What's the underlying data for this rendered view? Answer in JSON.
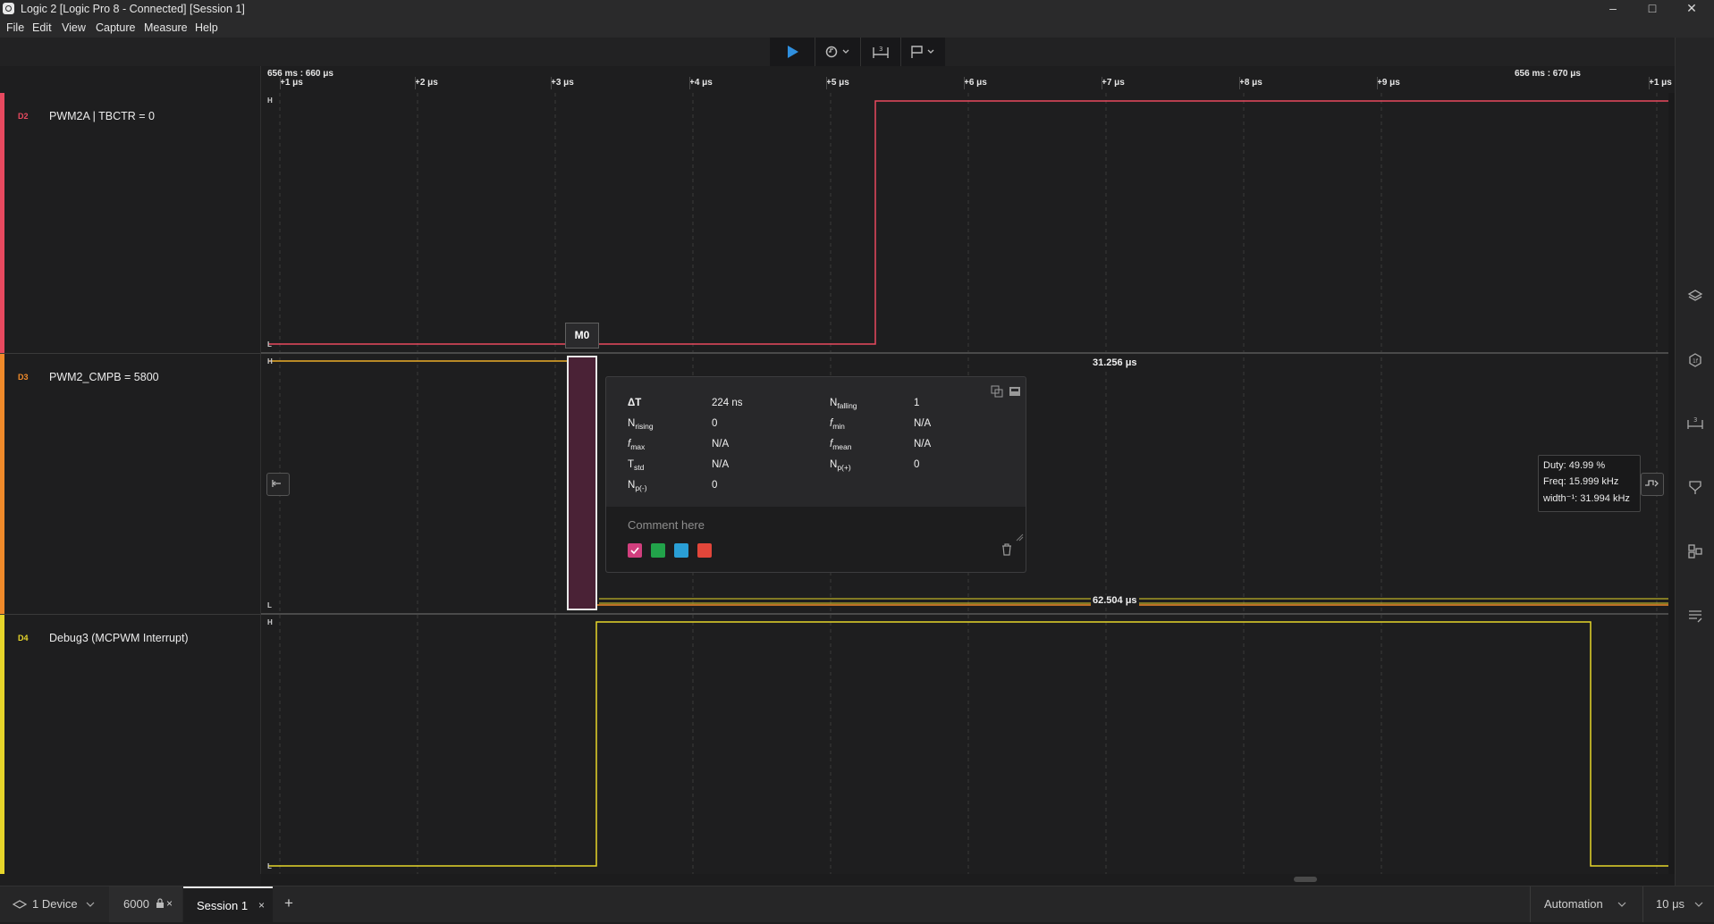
{
  "window": {
    "title": "Logic 2 [Logic Pro 8 - Connected] [Session 1]",
    "controls": {
      "minimize": "–",
      "maximize": "□",
      "close": "✕"
    }
  },
  "menu": [
    "File",
    "Edit",
    "View",
    "Capture",
    "Measure",
    "Help"
  ],
  "toolbar": {
    "play_icon": "play-icon",
    "trigger_icon": "trigger-icon",
    "measure_icon": "measure-icon",
    "marker_icon": "marker-icon"
  },
  "timeline": {
    "anchor_start": "656 ms : 660 μs",
    "anchor_end": "656 ms : 670 μs",
    "ticks": [
      "+1 μs",
      "+2 μs",
      "+3 μs",
      "+4 μs",
      "+5 μs",
      "+6 μs",
      "+7 μs",
      "+8 μs",
      "+9 μs",
      "+1 μs"
    ]
  },
  "channels": [
    {
      "id": "D2",
      "name": "PWM2A | TBCTR = 0",
      "color": "#e8495f"
    },
    {
      "id": "D3",
      "name": "PWM2_CMPB = 5800",
      "color": "#f08a2a"
    },
    {
      "id": "D4",
      "name": "Debug3 (MCPWM Interrupt)",
      "color": "#e6d52a"
    }
  ],
  "levels": {
    "high": "H",
    "low": "L"
  },
  "marker": {
    "label": "M0"
  },
  "measurements": {
    "width_label": "31.256 μs",
    "period_label": "62.504 μs"
  },
  "measurement_popup": {
    "stats": [
      {
        "label": "ΔT",
        "sub": "",
        "value": "224 ns"
      },
      {
        "label": "N",
        "sub": "falling",
        "value": "1"
      },
      {
        "label": "N",
        "sub": "rising",
        "value": "0"
      },
      {
        "label": "f",
        "sub": "min",
        "value": "N/A"
      },
      {
        "label": "f",
        "sub": "max",
        "value": "N/A"
      },
      {
        "label": "f",
        "sub": "mean",
        "value": "N/A"
      },
      {
        "label": "T",
        "sub": "std",
        "value": "N/A"
      },
      {
        "label": "N",
        "sub": "p(+)",
        "value": "0"
      },
      {
        "label": "N",
        "sub": "p(-)",
        "value": "0"
      }
    ],
    "comment_placeholder": "Comment here",
    "colors": [
      "#d13f7e",
      "#22a34a",
      "#2a9fd6",
      "#e2463a"
    ]
  },
  "tooltip": {
    "duty": "Duty: 49.99 %",
    "freq": "Freq: 15.999 kHz",
    "width": "width⁻¹: 31.994 kHz"
  },
  "statusbar": {
    "device": "1 Device",
    "sample_tab": "6000",
    "session_tab": "Session 1",
    "add_tab": "+",
    "automation": "Automation",
    "timescale": "10 μs"
  }
}
